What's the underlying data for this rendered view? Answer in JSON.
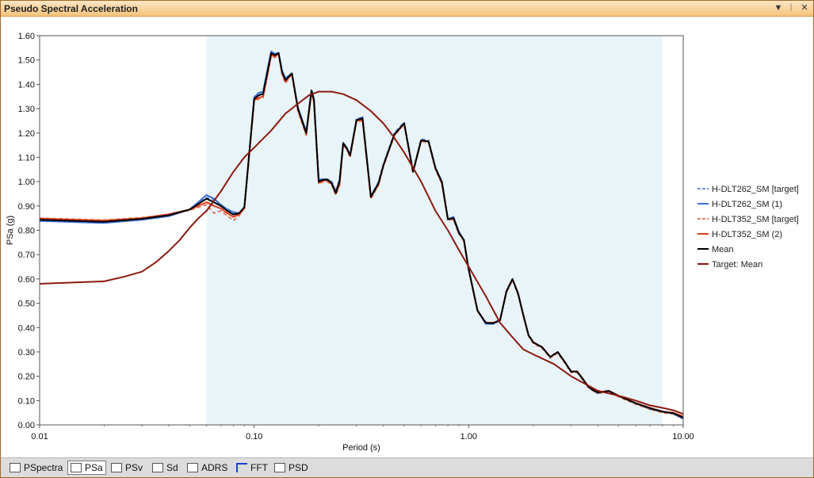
{
  "window": {
    "title": "Pseudo Spectral Acceleration",
    "buttons": [
      "▼",
      "ᛁ",
      "✕"
    ]
  },
  "tabs": [
    {
      "label": "PSpectra",
      "icon": "spectra-icon",
      "active": false
    },
    {
      "label": "PSa",
      "icon": "psa-icon",
      "active": true
    },
    {
      "label": "PSv",
      "icon": "psv-icon",
      "active": false
    },
    {
      "label": "Sd",
      "icon": "sd-icon",
      "active": false
    },
    {
      "label": "ADRS",
      "icon": "adrs-icon",
      "active": false
    },
    {
      "label": "FFT",
      "icon": "fft-icon",
      "active": false
    },
    {
      "label": "PSD",
      "icon": "psd-icon",
      "active": false
    }
  ],
  "chart_data": {
    "type": "line",
    "xlabel": "Period (s)",
    "ylabel": "PSa (g)",
    "xscale": "log",
    "xlim": [
      0.01,
      10
    ],
    "ylim": [
      0,
      1.6
    ],
    "xticks": [
      0.01,
      0.1,
      1,
      10
    ],
    "xtick_labels": [
      "0.01",
      "0.10",
      "1.00",
      "10.00"
    ],
    "yticks": [
      0,
      0.1,
      0.2,
      0.3,
      0.4,
      0.5,
      0.6,
      0.7,
      0.8,
      0.9,
      1.0,
      1.1,
      1.2,
      1.3,
      1.4,
      1.5,
      1.6
    ],
    "ytick_labels": [
      "0.00",
      "0.10",
      "0.20",
      "0.30",
      "0.40",
      "0.50",
      "0.60",
      "0.70",
      "0.80",
      "0.90",
      "1.00",
      "1.10",
      "1.20",
      "1.30",
      "1.40",
      "1.50",
      "1.60"
    ],
    "shaded_band": {
      "x": [
        0.06,
        8
      ],
      "color": "#e8f4f8"
    },
    "legend_position": "right",
    "series": [
      {
        "name": "H-DLT262_SM [target]",
        "color": "#6f8fd8",
        "dash": true,
        "x": [
          0.01,
          0.02,
          0.03,
          0.04,
          0.05,
          0.06,
          0.065,
          0.07,
          0.075,
          0.08,
          0.085,
          0.09,
          0.1,
          0.105,
          0.11,
          0.115,
          0.12,
          0.125,
          0.13,
          0.135,
          0.14,
          0.15,
          0.16,
          0.175,
          0.185,
          0.19,
          0.2,
          0.21,
          0.22,
          0.23,
          0.24,
          0.25,
          0.26,
          0.27,
          0.28,
          0.3,
          0.32,
          0.35,
          0.38,
          0.4,
          0.45,
          0.5,
          0.55,
          0.6,
          0.65,
          0.7,
          0.75,
          0.8,
          0.85,
          0.9,
          0.95,
          1,
          1.1,
          1.2,
          1.3,
          1.4,
          1.5,
          1.6,
          1.7,
          1.8,
          1.9,
          2,
          2.2,
          2.4,
          2.6,
          2.8,
          3,
          3.2,
          3.4,
          3.6,
          3.8,
          4,
          4.5,
          5,
          6,
          7,
          8,
          9,
          10
        ],
        "y": [
          0.84,
          0.832,
          0.845,
          0.86,
          0.885,
          0.935,
          0.925,
          0.9,
          0.89,
          0.87,
          0.865,
          0.89,
          1.35,
          1.36,
          1.37,
          1.45,
          1.53,
          1.52,
          1.53,
          1.45,
          1.42,
          1.445,
          1.3,
          1.2,
          1.38,
          1.34,
          1.01,
          1.01,
          1.01,
          1.0,
          0.96,
          1.01,
          1.16,
          1.14,
          1.11,
          1.26,
          1.26,
          0.94,
          1.0,
          1.07,
          1.2,
          1.245,
          1.045,
          1.175,
          1.17,
          1.06,
          1.0,
          0.85,
          0.85,
          0.79,
          0.76,
          0.64,
          0.47,
          0.42,
          0.42,
          0.43,
          0.55,
          0.6,
          0.54,
          0.45,
          0.37,
          0.34,
          0.32,
          0.28,
          0.3,
          0.26,
          0.22,
          0.22,
          0.19,
          0.16,
          0.145,
          0.135,
          0.14,
          0.12,
          0.09,
          0.07,
          0.055,
          0.05,
          0.03
        ]
      },
      {
        "name": "H-DLT262_SM (1)",
        "color": "#3a6fd8",
        "dash": false,
        "x": [
          0.01,
          0.02,
          0.03,
          0.04,
          0.05,
          0.06,
          0.065,
          0.07,
          0.075,
          0.08,
          0.085,
          0.09,
          0.1,
          0.105,
          0.11,
          0.115,
          0.12,
          0.125,
          0.13,
          0.135,
          0.14,
          0.15,
          0.16,
          0.175,
          0.185,
          0.19,
          0.2,
          0.21,
          0.22,
          0.23,
          0.24,
          0.25,
          0.26,
          0.27,
          0.28,
          0.3,
          0.32,
          0.35,
          0.38,
          0.4,
          0.45,
          0.5,
          0.55,
          0.6,
          0.65,
          0.7,
          0.75,
          0.8,
          0.85,
          0.9,
          0.95,
          1,
          1.1,
          1.2,
          1.3,
          1.4,
          1.5,
          1.6,
          1.7,
          1.8,
          1.9,
          2,
          2.2,
          2.4,
          2.6,
          2.8,
          3,
          3.2,
          3.4,
          3.6,
          3.8,
          4,
          4.5,
          5,
          6,
          7,
          8,
          9,
          10
        ],
        "y": [
          0.838,
          0.83,
          0.843,
          0.858,
          0.885,
          0.945,
          0.93,
          0.905,
          0.885,
          0.875,
          0.87,
          0.89,
          1.345,
          1.365,
          1.37,
          1.455,
          1.535,
          1.525,
          1.53,
          1.455,
          1.425,
          1.445,
          1.305,
          1.205,
          1.375,
          1.34,
          1.005,
          1.01,
          1.01,
          0.995,
          0.955,
          1.005,
          1.16,
          1.14,
          1.11,
          1.255,
          1.265,
          0.94,
          0.995,
          1.065,
          1.195,
          1.24,
          1.04,
          1.17,
          1.165,
          1.055,
          1.0,
          0.845,
          0.855,
          0.795,
          0.76,
          0.64,
          0.47,
          0.415,
          0.415,
          0.43,
          0.55,
          0.6,
          0.54,
          0.45,
          0.37,
          0.34,
          0.32,
          0.28,
          0.3,
          0.26,
          0.22,
          0.22,
          0.19,
          0.155,
          0.14,
          0.13,
          0.14,
          0.12,
          0.09,
          0.065,
          0.055,
          0.045,
          0.025
        ]
      },
      {
        "name": "H-DLT352_SM [target]",
        "color": "#e08060",
        "dash": true,
        "x": [
          0.01,
          0.02,
          0.03,
          0.04,
          0.05,
          0.06,
          0.065,
          0.07,
          0.075,
          0.08,
          0.085,
          0.09,
          0.1,
          0.105,
          0.11,
          0.115,
          0.12,
          0.125,
          0.13,
          0.135,
          0.14,
          0.15,
          0.16,
          0.175,
          0.185,
          0.19,
          0.2,
          0.21,
          0.22,
          0.23,
          0.24,
          0.25,
          0.26,
          0.27,
          0.28,
          0.3,
          0.32,
          0.35,
          0.38,
          0.4,
          0.45,
          0.5,
          0.55,
          0.6,
          0.65,
          0.7,
          0.75,
          0.8,
          0.85,
          0.9,
          0.95,
          1,
          1.1,
          1.2,
          1.3,
          1.4,
          1.5,
          1.6,
          1.7,
          1.8,
          1.9,
          2,
          2.2,
          2.4,
          2.6,
          2.8,
          3,
          3.2,
          3.4,
          3.6,
          3.8,
          4,
          4.5,
          5,
          6,
          7,
          8,
          9,
          10
        ],
        "y": [
          0.85,
          0.842,
          0.852,
          0.865,
          0.882,
          0.905,
          0.87,
          0.88,
          0.86,
          0.84,
          0.86,
          0.89,
          1.33,
          1.34,
          1.345,
          1.43,
          1.515,
          1.51,
          1.525,
          1.44,
          1.405,
          1.44,
          1.29,
          1.19,
          1.365,
          1.325,
          0.99,
          1.0,
          1.0,
          0.985,
          0.945,
          0.985,
          1.15,
          1.135,
          1.1,
          1.245,
          1.25,
          0.93,
          0.985,
          1.06,
          1.19,
          1.235,
          1.035,
          1.165,
          1.16,
          1.05,
          0.99,
          0.84,
          0.845,
          0.785,
          0.755,
          0.635,
          0.465,
          0.42,
          0.42,
          0.43,
          0.545,
          0.595,
          0.535,
          0.445,
          0.365,
          0.335,
          0.315,
          0.275,
          0.295,
          0.255,
          0.215,
          0.215,
          0.185,
          0.155,
          0.14,
          0.13,
          0.135,
          0.115,
          0.085,
          0.065,
          0.05,
          0.045,
          0.03
        ]
      },
      {
        "name": "H-DLT352_SM (2)",
        "color": "#e03c1c",
        "dash": false,
        "x": [
          0.01,
          0.02,
          0.03,
          0.04,
          0.05,
          0.06,
          0.065,
          0.07,
          0.075,
          0.08,
          0.085,
          0.09,
          0.1,
          0.105,
          0.11,
          0.115,
          0.12,
          0.125,
          0.13,
          0.135,
          0.14,
          0.15,
          0.16,
          0.175,
          0.185,
          0.19,
          0.2,
          0.21,
          0.22,
          0.23,
          0.24,
          0.25,
          0.26,
          0.27,
          0.28,
          0.3,
          0.32,
          0.35,
          0.38,
          0.4,
          0.45,
          0.5,
          0.55,
          0.6,
          0.65,
          0.7,
          0.75,
          0.8,
          0.85,
          0.9,
          0.95,
          1,
          1.1,
          1.2,
          1.3,
          1.4,
          1.5,
          1.6,
          1.7,
          1.8,
          1.9,
          2,
          2.2,
          2.4,
          2.6,
          2.8,
          3,
          3.2,
          3.4,
          3.6,
          3.8,
          4,
          4.5,
          5,
          6,
          7,
          8,
          9,
          10
        ],
        "y": [
          0.848,
          0.84,
          0.85,
          0.866,
          0.885,
          0.915,
          0.9,
          0.89,
          0.87,
          0.855,
          0.865,
          0.89,
          1.335,
          1.345,
          1.35,
          1.435,
          1.52,
          1.515,
          1.525,
          1.445,
          1.41,
          1.445,
          1.295,
          1.195,
          1.37,
          1.33,
          0.995,
          1.005,
          1.005,
          0.99,
          0.95,
          0.99,
          1.155,
          1.135,
          1.105,
          1.25,
          1.255,
          0.935,
          0.99,
          1.065,
          1.19,
          1.24,
          1.04,
          1.17,
          1.165,
          1.055,
          0.995,
          0.845,
          0.85,
          0.79,
          0.76,
          0.64,
          0.47,
          0.42,
          0.42,
          0.43,
          0.55,
          0.6,
          0.54,
          0.45,
          0.37,
          0.34,
          0.32,
          0.28,
          0.3,
          0.26,
          0.22,
          0.22,
          0.19,
          0.16,
          0.145,
          0.135,
          0.14,
          0.12,
          0.09,
          0.07,
          0.055,
          0.05,
          0.035
        ]
      },
      {
        "name": "Mean",
        "color": "#000000",
        "dash": false,
        "x": [
          0.01,
          0.02,
          0.03,
          0.04,
          0.05,
          0.06,
          0.065,
          0.07,
          0.075,
          0.08,
          0.085,
          0.09,
          0.1,
          0.105,
          0.11,
          0.115,
          0.12,
          0.125,
          0.13,
          0.135,
          0.14,
          0.15,
          0.16,
          0.175,
          0.185,
          0.19,
          0.2,
          0.21,
          0.22,
          0.23,
          0.24,
          0.25,
          0.26,
          0.27,
          0.28,
          0.3,
          0.32,
          0.35,
          0.38,
          0.4,
          0.45,
          0.5,
          0.55,
          0.6,
          0.65,
          0.7,
          0.75,
          0.8,
          0.85,
          0.9,
          0.95,
          1,
          1.1,
          1.2,
          1.3,
          1.4,
          1.5,
          1.6,
          1.7,
          1.8,
          1.9,
          2,
          2.2,
          2.4,
          2.6,
          2.8,
          3,
          3.2,
          3.4,
          3.6,
          3.8,
          4,
          4.5,
          5,
          6,
          7,
          8,
          9,
          10
        ],
        "y": [
          0.843,
          0.835,
          0.847,
          0.862,
          0.885,
          0.93,
          0.915,
          0.9,
          0.88,
          0.865,
          0.87,
          0.895,
          1.34,
          1.355,
          1.36,
          1.445,
          1.528,
          1.52,
          1.528,
          1.45,
          1.418,
          1.445,
          1.3,
          1.2,
          1.375,
          1.335,
          1.0,
          1.008,
          1.008,
          0.993,
          0.953,
          1.0,
          1.158,
          1.138,
          1.108,
          1.253,
          1.26,
          0.938,
          0.993,
          1.066,
          1.194,
          1.24,
          1.04,
          1.17,
          1.165,
          1.055,
          0.998,
          0.845,
          0.85,
          0.79,
          0.76,
          0.64,
          0.47,
          0.42,
          0.418,
          0.43,
          0.549,
          0.599,
          0.539,
          0.449,
          0.369,
          0.339,
          0.319,
          0.279,
          0.299,
          0.259,
          0.219,
          0.219,
          0.189,
          0.158,
          0.143,
          0.133,
          0.139,
          0.119,
          0.089,
          0.068,
          0.054,
          0.048,
          0.03
        ]
      },
      {
        "name": "Target: Mean",
        "color": "#8b1a10",
        "dash": false,
        "x": [
          0.01,
          0.02,
          0.025,
          0.03,
          0.035,
          0.04,
          0.045,
          0.05,
          0.055,
          0.06,
          0.07,
          0.08,
          0.09,
          0.1,
          0.12,
          0.14,
          0.16,
          0.18,
          0.2,
          0.23,
          0.26,
          0.3,
          0.35,
          0.4,
          0.45,
          0.5,
          0.6,
          0.7,
          0.8,
          0.9,
          1,
          1.2,
          1.4,
          1.6,
          1.8,
          2,
          2.5,
          3,
          4,
          5,
          6,
          7,
          8,
          9,
          10
        ],
        "y": [
          0.58,
          0.59,
          0.61,
          0.63,
          0.67,
          0.715,
          0.76,
          0.81,
          0.85,
          0.88,
          0.96,
          1.04,
          1.1,
          1.14,
          1.21,
          1.28,
          1.32,
          1.355,
          1.37,
          1.37,
          1.36,
          1.335,
          1.29,
          1.24,
          1.18,
          1.12,
          1.0,
          0.88,
          0.8,
          0.72,
          0.65,
          0.53,
          0.42,
          0.36,
          0.31,
          0.29,
          0.25,
          0.2,
          0.14,
          0.12,
          0.1,
          0.08,
          0.07,
          0.06,
          0.045
        ]
      }
    ]
  }
}
